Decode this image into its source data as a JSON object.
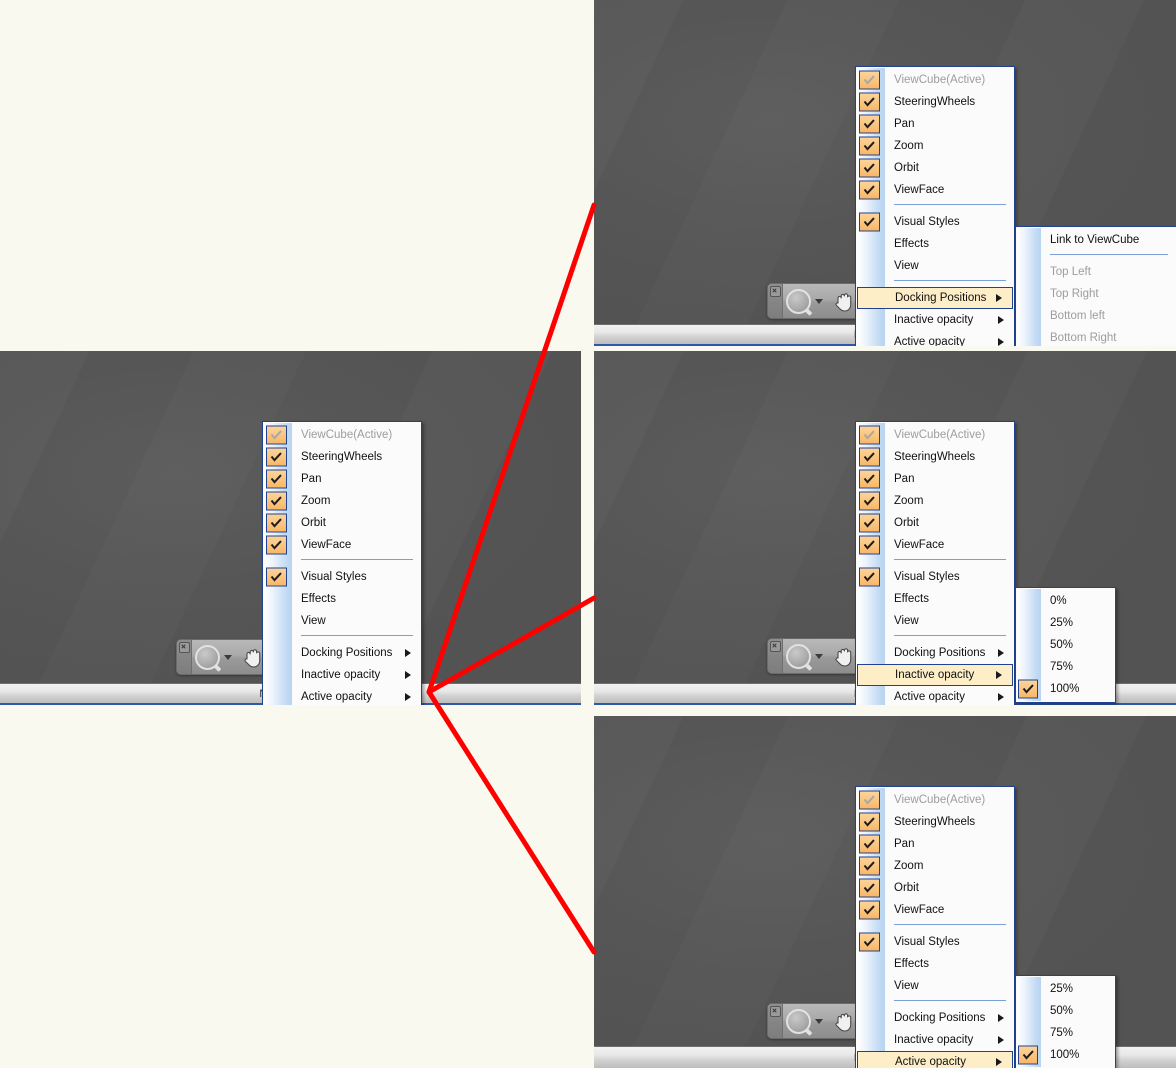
{
  "figure": {
    "background_color": "#f9f9ef",
    "annotation_color": "#ff0000",
    "viewport_color": "#585858",
    "accent_color": "#21428f",
    "check_color": "#fbc47e",
    "highlight_color": "#fdeec8"
  },
  "status_bar": {
    "text": "No Selection"
  },
  "nav_bar_widget": {
    "close_icon": "close-icon",
    "zoom_icon": "magnifier-zoom-icon",
    "dropdown_icon": "chevron-down-icon",
    "pan_icon": "hand-pan-icon"
  },
  "context_menu": {
    "items": [
      {
        "label": "ViewCube(Active)",
        "checked": true,
        "disabled": true,
        "submenu": false
      },
      {
        "label": "SteeringWheels",
        "checked": true,
        "disabled": false,
        "submenu": false
      },
      {
        "label": "Pan",
        "checked": true,
        "disabled": false,
        "submenu": false
      },
      {
        "label": "Zoom",
        "checked": true,
        "disabled": false,
        "submenu": false
      },
      {
        "label": "Orbit",
        "checked": true,
        "disabled": false,
        "submenu": false
      },
      {
        "label": "ViewFace",
        "checked": true,
        "disabled": false,
        "submenu": false
      },
      {
        "label": "Visual Styles",
        "checked": true,
        "disabled": false,
        "submenu": false
      },
      {
        "label": "Effects",
        "checked": false,
        "disabled": false,
        "submenu": false
      },
      {
        "label": "View",
        "checked": false,
        "disabled": false,
        "submenu": false
      },
      {
        "label": "Docking Positions",
        "checked": false,
        "disabled": false,
        "submenu": true
      },
      {
        "label": "Inactive opacity",
        "checked": false,
        "disabled": false,
        "submenu": true
      },
      {
        "label": "Active opacity",
        "checked": false,
        "disabled": false,
        "submenu": true
      }
    ],
    "separator_after_indexes": [
      5,
      8
    ]
  },
  "submenus": {
    "docking_positions": {
      "title": "Docking Positions",
      "items": [
        {
          "label": "Link to ViewCube",
          "disabled": false,
          "checked": false
        },
        {
          "label": "Top Left",
          "disabled": true,
          "checked": false
        },
        {
          "label": "Top Right",
          "disabled": true,
          "checked": false
        },
        {
          "label": "Bottom left",
          "disabled": true,
          "checked": false
        },
        {
          "label": "Bottom Right",
          "disabled": true,
          "checked": false
        }
      ],
      "separator_after_indexes": [
        0
      ]
    },
    "inactive_opacity": {
      "title": "Inactive opacity",
      "items": [
        {
          "label": "0%",
          "checked": false,
          "disabled": false
        },
        {
          "label": "25%",
          "checked": false,
          "disabled": false
        },
        {
          "label": "50%",
          "checked": false,
          "disabled": false
        },
        {
          "label": "75%",
          "checked": false,
          "disabled": false
        },
        {
          "label": "100%",
          "checked": true,
          "disabled": false
        }
      ],
      "separator_after_indexes": []
    },
    "active_opacity": {
      "title": "Active opacity",
      "items": [
        {
          "label": "25%",
          "checked": false,
          "disabled": false
        },
        {
          "label": "50%",
          "checked": false,
          "disabled": false
        },
        {
          "label": "75%",
          "checked": false,
          "disabled": false
        },
        {
          "label": "100%",
          "checked": true,
          "disabled": false
        }
      ],
      "separator_after_indexes": []
    }
  },
  "panels": [
    {
      "id": "top-right",
      "highlighted_item": "Docking Positions",
      "open_submenu": "docking_positions"
    },
    {
      "id": "bottom-left",
      "highlighted_item": null,
      "open_submenu": null
    },
    {
      "id": "middle-right",
      "highlighted_item": "Inactive opacity",
      "open_submenu": "inactive_opacity"
    },
    {
      "id": "bottom-right",
      "highlighted_item": "Active opacity",
      "open_submenu": "active_opacity"
    }
  ]
}
